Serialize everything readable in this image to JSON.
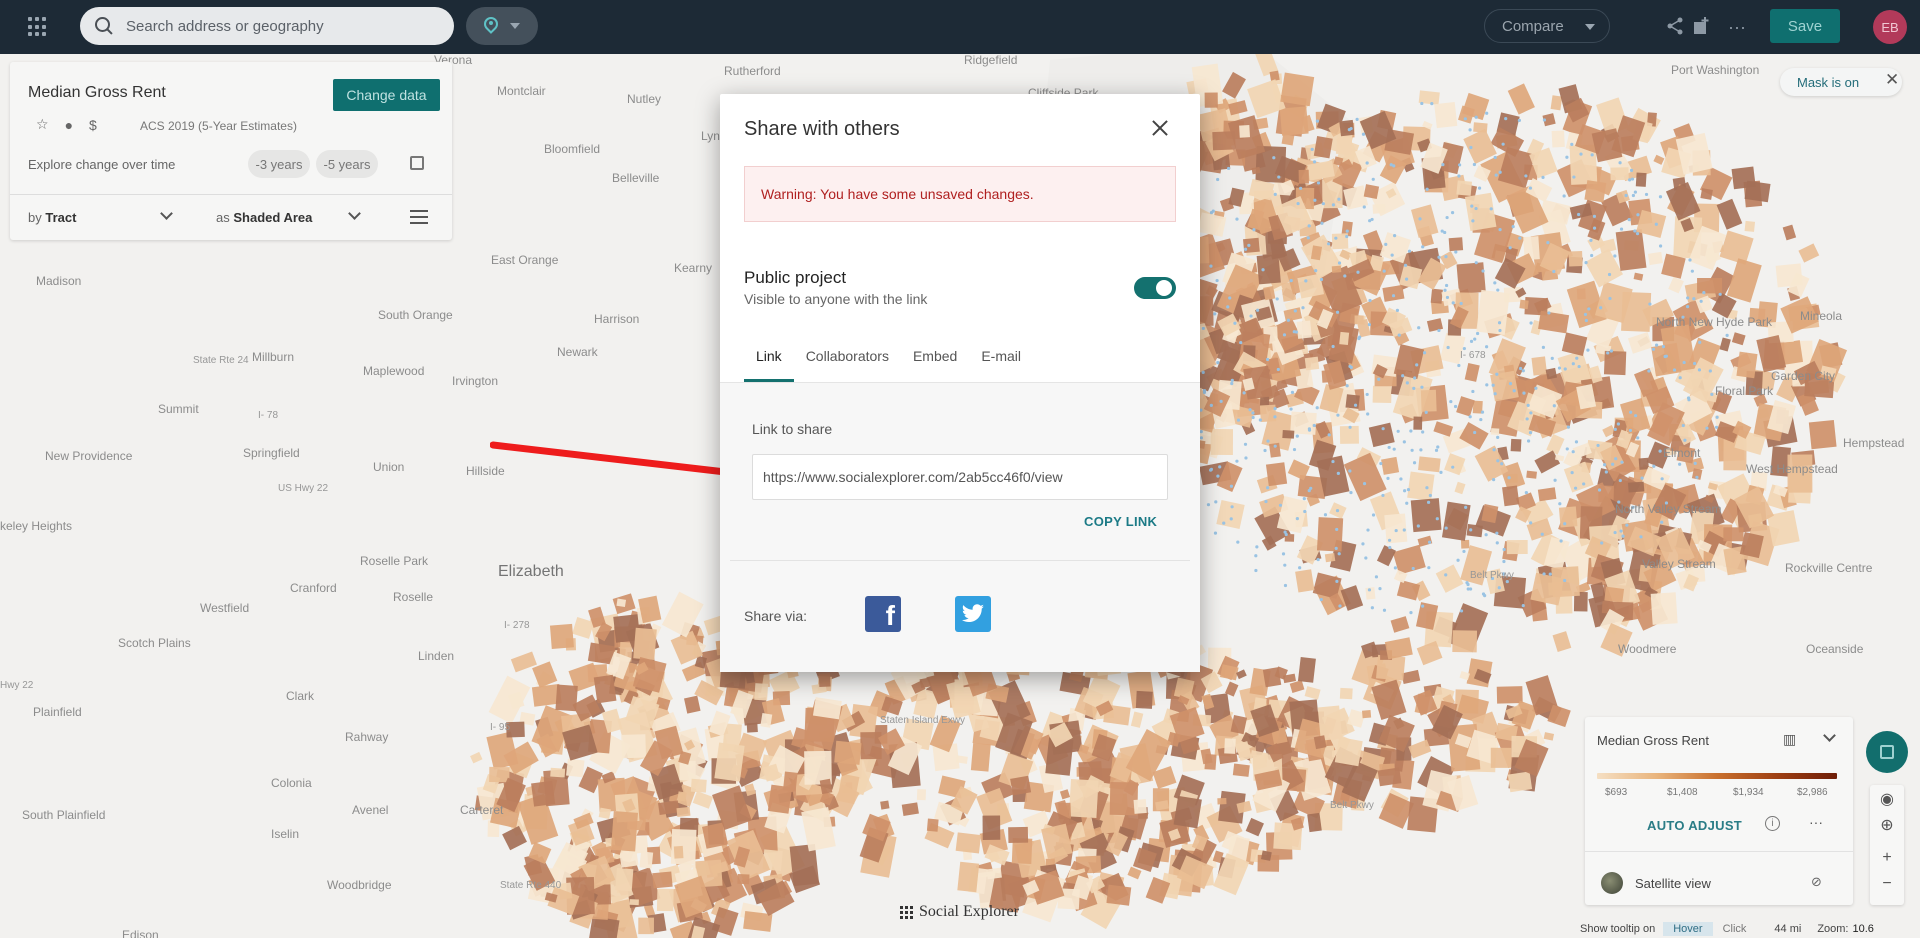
{
  "topbar": {
    "search_placeholder": "Search address or geography",
    "compare_label": "Compare",
    "save_label": "Save",
    "avatar_initials": "EB"
  },
  "data_panel": {
    "title": "Median Gross Rent",
    "change_data_label": "Change data",
    "survey": "ACS 2019 (5-Year Estimates)",
    "explore_label": "Explore change over time",
    "minus3_label": "-3 years",
    "minus5_label": "-5 years",
    "by_prefix": "by",
    "by_value": "Tract",
    "as_prefix": "as",
    "as_value": "Shaded Area"
  },
  "mask": {
    "label": "Mask is on"
  },
  "modal": {
    "title": "Share with others",
    "warning": "Warning: You have some unsaved changes.",
    "public_title": "Public project",
    "public_subtitle": "Visible to anyone with the link",
    "public_enabled": true,
    "tabs": [
      {
        "label": "Link",
        "active": true
      },
      {
        "label": "Collaborators",
        "active": false
      },
      {
        "label": "Embed",
        "active": false
      },
      {
        "label": "E-mail",
        "active": false
      }
    ],
    "link_to_share_label": "Link to share",
    "link_value": "https://www.socialexplorer.com/2ab5cc46f0/view",
    "copy_link_label": "COPY LINK",
    "share_via_label": "Share via:"
  },
  "legend": {
    "title": "Median Gross Rent",
    "values": [
      "$693",
      "$1,408",
      "$1,934",
      "$2,986"
    ],
    "auto_adjust_label": "AUTO ADJUST",
    "satellite_label": "Satellite view"
  },
  "bottom": {
    "tooltip_label": "Show tooltip on",
    "hover_label": "Hover",
    "click_label": "Click",
    "scale": "44 mi",
    "zoom_label": "Zoom:",
    "zoom_value": "10.6",
    "logo_text": "Social Explorer"
  },
  "map_places": [
    "Verona",
    "Rutherford",
    "Ridgefield",
    "Cliffside Park",
    "Port Washington",
    "Montclair",
    "Nutley",
    "Bloomfield",
    "Belleville",
    "Lyn",
    "East Orange",
    "Kearny",
    "Madison",
    "South Orange",
    "Harrison",
    "Newark",
    "Millburn",
    "Maplewood",
    "Irvington",
    "Summit",
    "State Rte 24",
    "I- 78",
    "New Providence",
    "Springfield",
    "Union",
    "Hillside",
    "US Hwy 22",
    "keley Heights",
    "Roselle Park",
    "Elizabeth",
    "Cranford",
    "Roselle",
    "Westfield",
    "I- 278",
    "Scotch Plains",
    "Linden",
    "Hwy 22",
    "Plainfield",
    "Clark",
    "Rahway",
    "I- 95",
    "Colonia",
    "South Plainfield",
    "Avenel",
    "Carteret",
    "Iselin",
    "Woodbridge",
    "State Rte 440",
    "Edison",
    "Mineola",
    "North New Hyde Park",
    "Garden City",
    "Floral Park",
    "Hempstead",
    "Elmont",
    "West Hempstead",
    "North Valley Stream",
    "Valley Stream",
    "Rockville Centre",
    "Woodmere",
    "Oceanside",
    "Belt Pkwy",
    "I- 678",
    "Staten Island Exwy",
    "Belt Pkwy"
  ]
}
